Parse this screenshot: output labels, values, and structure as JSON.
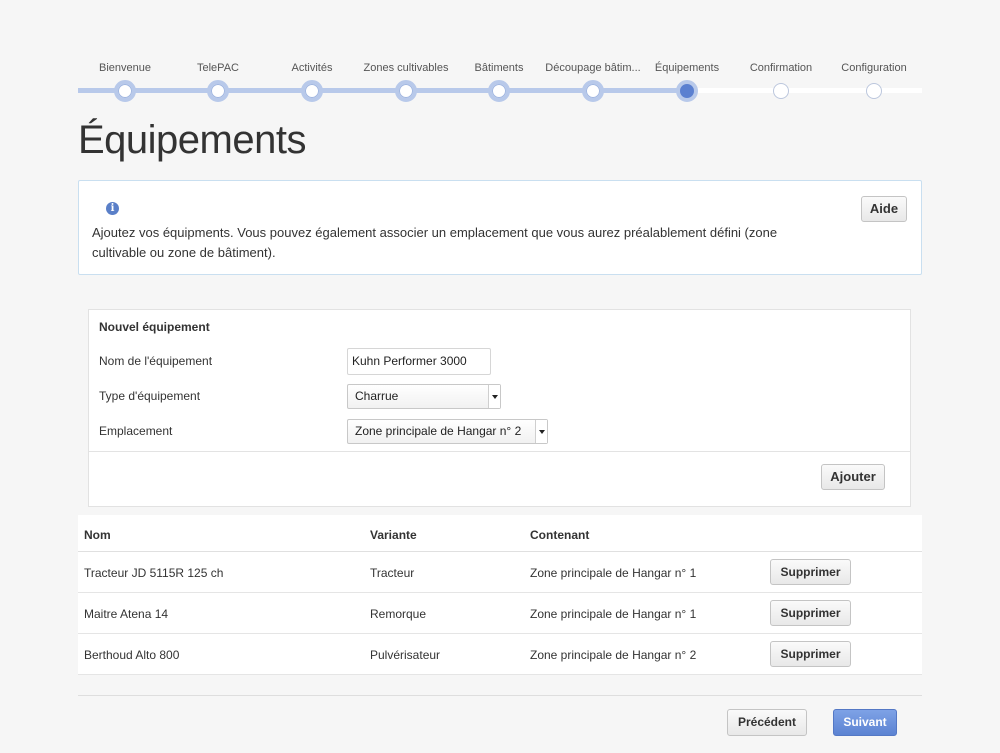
{
  "stepper": {
    "steps": [
      {
        "label": "Bienvenue",
        "state": "done"
      },
      {
        "label": "TelePAC",
        "state": "done"
      },
      {
        "label": "Activités",
        "state": "done"
      },
      {
        "label": "Zones cultivables",
        "state": "done"
      },
      {
        "label": "Bâtiments",
        "state": "done"
      },
      {
        "label": "Découpage bâtim...",
        "state": "done"
      },
      {
        "label": "Équipements",
        "state": "current"
      },
      {
        "label": "Confirmation",
        "state": "todo"
      },
      {
        "label": "Configuration",
        "state": "todo"
      }
    ]
  },
  "page": {
    "title": "Équipements"
  },
  "info": {
    "icon": "info-icon",
    "text": "Ajoutez vos équipments. Vous pouvez également associer un emplacement que vous aurez préalablement défini (zone cultivable ou zone de bâtiment).",
    "help_label": "Aide"
  },
  "form": {
    "title": "Nouvel équipement",
    "name_label": "Nom de l'équipement",
    "name_value": "Kuhn Performer 3000",
    "type_label": "Type d'équipement",
    "type_value": "Charrue",
    "location_label": "Emplacement",
    "location_value": "Zone principale de Hangar n° 2",
    "add_label": "Ajouter"
  },
  "table": {
    "headers": {
      "nom": "Nom",
      "variante": "Variante",
      "contenant": "Contenant"
    },
    "rows": [
      {
        "nom": "Tracteur JD 5115R 125 ch",
        "variante": "Tracteur",
        "contenant": "Zone principale de Hangar n° 1",
        "action": "Supprimer"
      },
      {
        "nom": "Maitre Atena 14",
        "variante": "Remorque",
        "contenant": "Zone principale de Hangar n° 1",
        "action": "Supprimer"
      },
      {
        "nom": "Berthoud Alto 800",
        "variante": "Pulvérisateur",
        "contenant": "Zone principale de Hangar n° 2",
        "action": "Supprimer"
      }
    ]
  },
  "footer": {
    "previous_label": "Précédent",
    "next_label": "Suivant"
  },
  "colors": {
    "accent": "#5b80d0",
    "stepper_track": "#b8c9ea",
    "info_border": "#c9dff0"
  }
}
